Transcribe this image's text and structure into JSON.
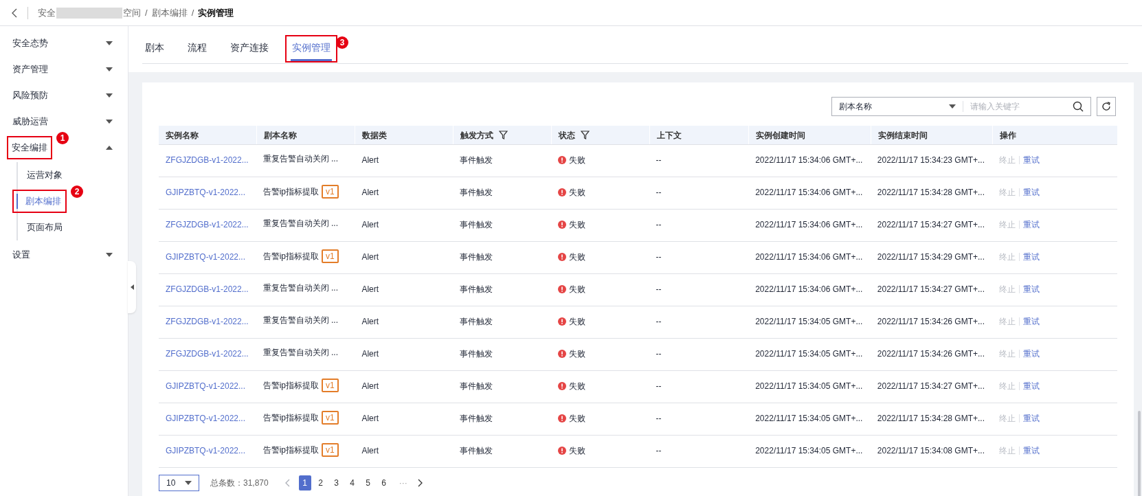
{
  "breadcrumb": {
    "parts": [
      {
        "text": "安全",
        "current": false,
        "redacted_after": true
      },
      {
        "text": "空间",
        "current": false,
        "redacted_after": false
      },
      {
        "text": "剧本编排",
        "current": false,
        "redacted_after": false
      },
      {
        "text": "实例管理",
        "current": true,
        "redacted_after": false
      }
    ],
    "separator": "/"
  },
  "sidebar": {
    "items": [
      {
        "label": "安全态势",
        "expanded": false
      },
      {
        "label": "资产管理",
        "expanded": false
      },
      {
        "label": "风险预防",
        "expanded": false
      },
      {
        "label": "威胁运营",
        "expanded": false
      },
      {
        "label": "安全编排",
        "expanded": true,
        "callout": "1",
        "children": [
          {
            "label": "运营对象",
            "selected": false
          },
          {
            "label": "剧本编排",
            "selected": true,
            "callout": "2"
          },
          {
            "label": "页面布局",
            "selected": false
          }
        ]
      },
      {
        "label": "设置",
        "expanded": false
      }
    ]
  },
  "tabs": [
    {
      "label": "剧本",
      "selected": false
    },
    {
      "label": "流程",
      "selected": false
    },
    {
      "label": "资产连接",
      "selected": false
    },
    {
      "label": "实例管理",
      "selected": true,
      "callout": "3"
    }
  ],
  "search": {
    "field": "剧本名称",
    "placeholder": "请输入关键字"
  },
  "table": {
    "columns": [
      {
        "label": "实例名称"
      },
      {
        "label": "剧本名称"
      },
      {
        "label": "数据类"
      },
      {
        "label": "触发方式",
        "filterable": true
      },
      {
        "label": "状态",
        "filterable": true
      },
      {
        "label": "上下文"
      },
      {
        "label": "实例创建时间"
      },
      {
        "label": "实例结束时间"
      },
      {
        "label": "操作"
      }
    ],
    "rows": [
      {
        "instance": "ZFGJZDGB-v1-2022...",
        "playbook": "重复告警自动关闭 ...",
        "version": null,
        "data_class": "Alert",
        "trigger": "事件触发",
        "status": "失败",
        "context": "--",
        "created": "2022/11/17 15:34:06 GMT+...",
        "ended": "2022/11/17 15:34:23 GMT+...",
        "actions": [
          {
            "label": "终止",
            "disabled": true
          },
          {
            "label": "重试",
            "disabled": false
          }
        ]
      },
      {
        "instance": "GJIPZBTQ-v1-2022...",
        "playbook": "告警ip指标提取",
        "version": "v1",
        "data_class": "Alert",
        "trigger": "事件触发",
        "status": "失败",
        "context": "--",
        "created": "2022/11/17 15:34:06 GMT+...",
        "ended": "2022/11/17 15:34:28 GMT+...",
        "actions": [
          {
            "label": "终止",
            "disabled": true
          },
          {
            "label": "重试",
            "disabled": false
          }
        ]
      },
      {
        "instance": "ZFGJZDGB-v1-2022...",
        "playbook": "重复告警自动关闭 ...",
        "version": null,
        "data_class": "Alert",
        "trigger": "事件触发",
        "status": "失败",
        "context": "--",
        "created": "2022/11/17 15:34:06 GMT+...",
        "ended": "2022/11/17 15:34:27 GMT+...",
        "actions": [
          {
            "label": "终止",
            "disabled": true
          },
          {
            "label": "重试",
            "disabled": false
          }
        ]
      },
      {
        "instance": "GJIPZBTQ-v1-2022...",
        "playbook": "告警ip指标提取",
        "version": "v1",
        "data_class": "Alert",
        "trigger": "事件触发",
        "status": "失败",
        "context": "--",
        "created": "2022/11/17 15:34:06 GMT+...",
        "ended": "2022/11/17 15:34:29 GMT+...",
        "actions": [
          {
            "label": "终止",
            "disabled": true
          },
          {
            "label": "重试",
            "disabled": false
          }
        ]
      },
      {
        "instance": "ZFGJZDGB-v1-2022...",
        "playbook": "重复告警自动关闭 ...",
        "version": null,
        "data_class": "Alert",
        "trigger": "事件触发",
        "status": "失败",
        "context": "--",
        "created": "2022/11/17 15:34:06 GMT+...",
        "ended": "2022/11/17 15:34:27 GMT+...",
        "actions": [
          {
            "label": "终止",
            "disabled": true
          },
          {
            "label": "重试",
            "disabled": false
          }
        ]
      },
      {
        "instance": "ZFGJZDGB-v1-2022...",
        "playbook": "重复告警自动关闭 ...",
        "version": null,
        "data_class": "Alert",
        "trigger": "事件触发",
        "status": "失败",
        "context": "--",
        "created": "2022/11/17 15:34:05 GMT+...",
        "ended": "2022/11/17 15:34:26 GMT+...",
        "actions": [
          {
            "label": "终止",
            "disabled": true
          },
          {
            "label": "重试",
            "disabled": false
          }
        ]
      },
      {
        "instance": "ZFGJZDGB-v1-2022...",
        "playbook": "重复告警自动关闭 ...",
        "version": null,
        "data_class": "Alert",
        "trigger": "事件触发",
        "status": "失败",
        "context": "--",
        "created": "2022/11/17 15:34:05 GMT+...",
        "ended": "2022/11/17 15:34:26 GMT+...",
        "actions": [
          {
            "label": "终止",
            "disabled": true
          },
          {
            "label": "重试",
            "disabled": false
          }
        ]
      },
      {
        "instance": "GJIPZBTQ-v1-2022...",
        "playbook": "告警ip指标提取",
        "version": "v1",
        "data_class": "Alert",
        "trigger": "事件触发",
        "status": "失败",
        "context": "--",
        "created": "2022/11/17 15:34:05 GMT+...",
        "ended": "2022/11/17 15:34:27 GMT+...",
        "actions": [
          {
            "label": "终止",
            "disabled": true
          },
          {
            "label": "重试",
            "disabled": false
          }
        ]
      },
      {
        "instance": "GJIPZBTQ-v1-2022...",
        "playbook": "告警ip指标提取",
        "version": "v1",
        "data_class": "Alert",
        "trigger": "事件触发",
        "status": "失败",
        "context": "--",
        "created": "2022/11/17 15:34:05 GMT+...",
        "ended": "2022/11/17 15:34:28 GMT+...",
        "actions": [
          {
            "label": "终止",
            "disabled": true
          },
          {
            "label": "重试",
            "disabled": false
          }
        ]
      },
      {
        "instance": "GJIPZBTQ-v1-2022...",
        "playbook": "告警ip指标提取",
        "version": "v1",
        "data_class": "Alert",
        "trigger": "事件触发",
        "status": "失败",
        "context": "--",
        "created": "2022/11/17 15:34:05 GMT+...",
        "ended": "2022/11/17 15:34:08 GMT+...",
        "actions": [
          {
            "label": "终止",
            "disabled": true
          },
          {
            "label": "重试",
            "disabled": false
          }
        ]
      }
    ]
  },
  "pagination": {
    "page_size": "10",
    "total": "总条数：31,870",
    "pages": [
      {
        "label": "1",
        "selected": true
      },
      {
        "label": "2",
        "selected": false
      },
      {
        "label": "3",
        "selected": false
      },
      {
        "label": "4",
        "selected": false
      },
      {
        "label": "5",
        "selected": false
      },
      {
        "label": "6",
        "selected": false
      }
    ],
    "ellipsis": "···"
  }
}
